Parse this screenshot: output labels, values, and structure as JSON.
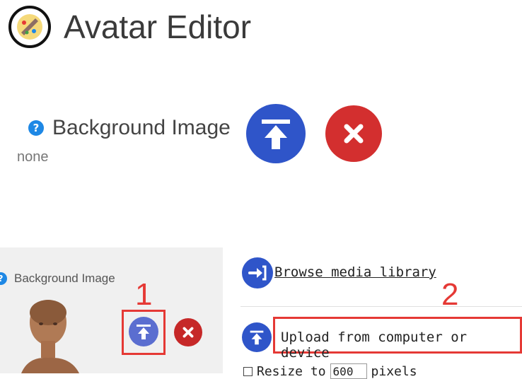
{
  "header": {
    "title": "Avatar Editor"
  },
  "background_field": {
    "label": "Background Image",
    "value": "none",
    "help_glyph": "?",
    "upload_icon": "upload-icon",
    "remove_icon": "close-icon",
    "colors": {
      "upload": "#2f55c9",
      "remove": "#d32f2f",
      "help": "#1e88e5"
    }
  },
  "lower_panel": {
    "label": "Background Image",
    "help_glyph": "?"
  },
  "media_options": {
    "browse_label": " Browse media library",
    "upload_label": "Upload from computer or device",
    "resize_prefix": "Resize to",
    "resize_value": "600",
    "resize_suffix": "pixels"
  },
  "annotations": {
    "step1": "1",
    "step2": "2",
    "color": "#e53935"
  }
}
